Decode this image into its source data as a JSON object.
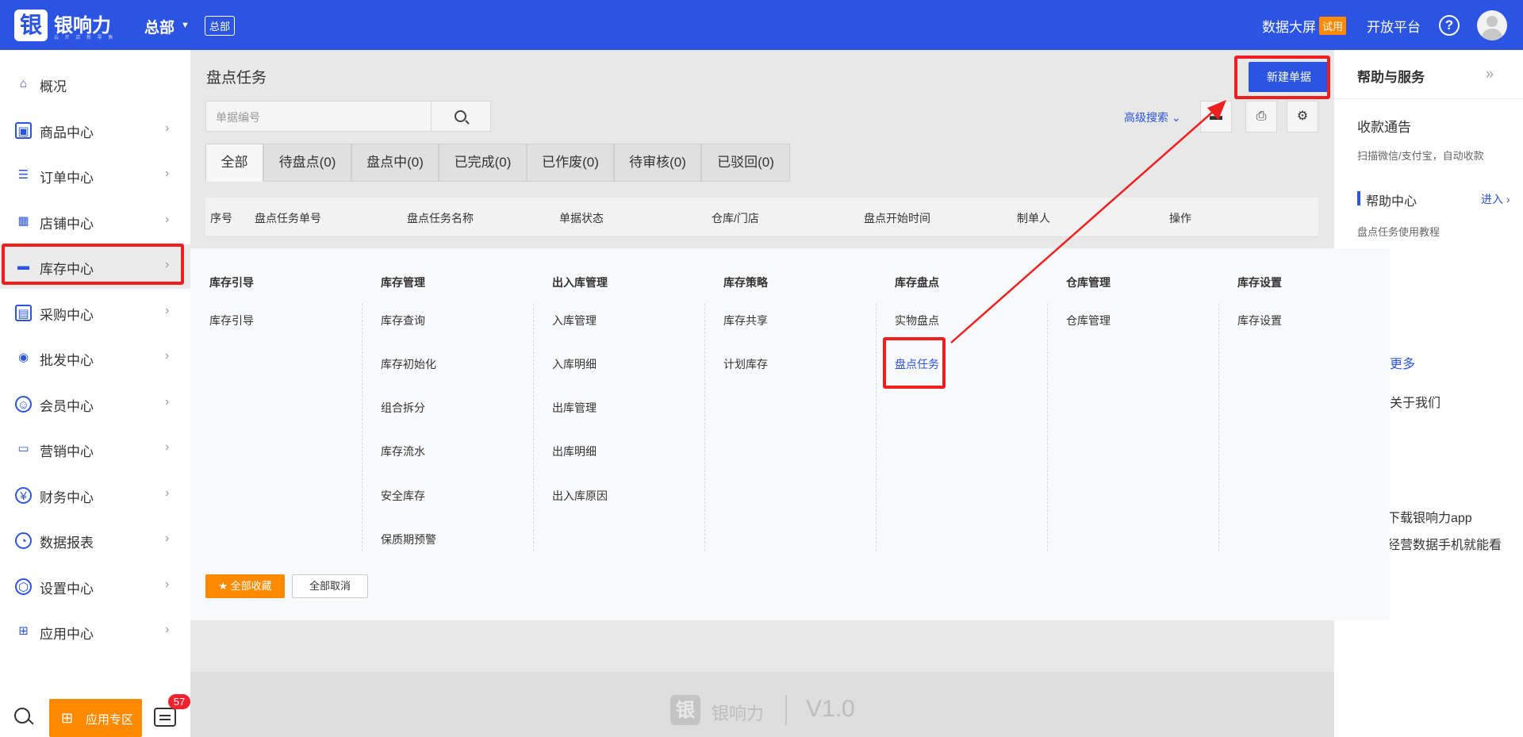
{
  "header": {
    "logo_glyph": "银",
    "brand": "银响力",
    "brand_sub": "云 开 店 新 零 售",
    "org": "总部",
    "org_tag": "总部",
    "data_screen": "数据大屏",
    "trial": "试用",
    "open_platform": "开放平台",
    "help_glyph": "?"
  },
  "sidebar": {
    "items": [
      {
        "label": "概况",
        "icon": "home-icon"
      },
      {
        "label": "商品中心",
        "icon": "bag-icon"
      },
      {
        "label": "订单中心",
        "icon": "clipboard-icon"
      },
      {
        "label": "店铺中心",
        "icon": "store-icon"
      },
      {
        "label": "库存中心",
        "icon": "warehouse-icon"
      },
      {
        "label": "采购中心",
        "icon": "purchase-icon"
      },
      {
        "label": "批发中心",
        "icon": "wholesale-icon"
      },
      {
        "label": "会员中心",
        "icon": "member-icon"
      },
      {
        "label": "营销中心",
        "icon": "ticket-icon"
      },
      {
        "label": "财务中心",
        "icon": "yen-icon"
      },
      {
        "label": "数据报表",
        "icon": "pie-chart-icon"
      },
      {
        "label": "设置中心",
        "icon": "settings-icon"
      },
      {
        "label": "应用中心",
        "icon": "apps-icon"
      }
    ],
    "chevron": "›",
    "app_zone": "应用专区",
    "message_badge": "57"
  },
  "main": {
    "title": "盘点任务",
    "new_button": "新建单据",
    "search_placeholder": "单据编号",
    "advanced_search": "高级搜索",
    "tabs": [
      "全部",
      "待盘点(0)",
      "盘点中(0)",
      "已完成(0)",
      "已作废(0)",
      "待审核(0)",
      "已驳回(0)"
    ],
    "columns": [
      "序号",
      "盘点任务单号",
      "盘点任务名称",
      "单据状态",
      "仓库/门店",
      "盘点开始时间",
      "制单人",
      "操作"
    ],
    "footer_brand": "银响力",
    "footer_version": "V1.0"
  },
  "mega_menu": {
    "columns": [
      {
        "title": "库存引导",
        "links": [
          "库存引导"
        ]
      },
      {
        "title": "库存管理",
        "links": [
          "库存查询",
          "库存初始化",
          "组合拆分",
          "库存流水",
          "安全库存",
          "保质期预警"
        ]
      },
      {
        "title": "出入库管理",
        "links": [
          "入库管理",
          "入库明细",
          "出库管理",
          "出库明细",
          "出入库原因"
        ]
      },
      {
        "title": "库存策略",
        "links": [
          "库存共享",
          "计划库存"
        ]
      },
      {
        "title": "库存盘点",
        "links": [
          "实物盘点",
          "盘点任务"
        ]
      },
      {
        "title": "仓库管理",
        "links": [
          "仓库管理"
        ]
      },
      {
        "title": "库存设置",
        "links": [
          "库存设置"
        ]
      }
    ],
    "fav_all": "全部收藏",
    "cancel_all": "全部取消"
  },
  "right_panel": {
    "title": "帮助与服务",
    "notice_title": "收款通告",
    "notice_text": "扫描微信/支付宝，自动收款",
    "help_center": "帮助中心",
    "enter": "进入",
    "tutorial": "盘点任务使用教程",
    "more": "更多",
    "contact": "关于我们",
    "app_title": "下载银响力app",
    "app_text": "经营数据手机就能看"
  },
  "colors": {
    "primary": "#2c54e2",
    "orange": "#ff8a00",
    "annotation_red": "#f01f1f"
  }
}
